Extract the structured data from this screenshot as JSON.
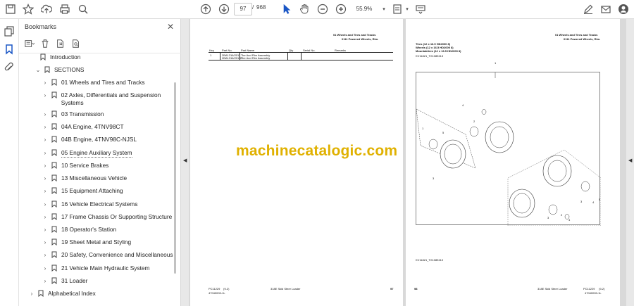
{
  "toolbar": {
    "current_page": "97",
    "page_separator": "/",
    "total_pages": "968",
    "zoom": "55.9%"
  },
  "bookmarks_panel": {
    "title": "Bookmarks",
    "items": [
      {
        "label": "Introduction",
        "level": 2,
        "expand": "none"
      },
      {
        "label": "SECTIONS",
        "level": 1,
        "expand": "expanded"
      },
      {
        "label": "01 Wheels and Tires and Tracks",
        "level": 2,
        "expand": "collapsed"
      },
      {
        "label": "02 Axles, Differentials and Suspension Systems",
        "level": 2,
        "expand": "collapsed"
      },
      {
        "label": "03 Transmission",
        "level": 2,
        "expand": "collapsed"
      },
      {
        "label": "04A Engine, 4TNV98CT",
        "level": 2,
        "expand": "collapsed"
      },
      {
        "label": "04B Engine, 4TNV98C-NJSL",
        "level": 2,
        "expand": "collapsed"
      },
      {
        "label": "05 Engine Auxiliary System",
        "level": 2,
        "expand": "collapsed"
      },
      {
        "label": "10 Service Brakes",
        "level": 2,
        "expand": "collapsed"
      },
      {
        "label": "13 Miscellaneous Vehicle",
        "level": 2,
        "expand": "collapsed"
      },
      {
        "label": "15 Equipment Attaching",
        "level": 2,
        "expand": "collapsed"
      },
      {
        "label": "16 Vehicle Electrical Systems",
        "level": 2,
        "expand": "collapsed"
      },
      {
        "label": "17 Frame Chassis Or Supporting Structure",
        "level": 2,
        "expand": "collapsed"
      },
      {
        "label": "18 Operator's Station",
        "level": 2,
        "expand": "collapsed"
      },
      {
        "label": "19 Sheet Metal and Styling",
        "level": 2,
        "expand": "collapsed"
      },
      {
        "label": "20 Safety, Convenience and Miscellaneous",
        "level": 2,
        "expand": "collapsed"
      },
      {
        "label": "21 Vehicle Main Hydraulic System",
        "level": 2,
        "expand": "collapsed"
      },
      {
        "label": "31 Loader",
        "level": 2,
        "expand": "collapsed"
      },
      {
        "label": "Alphabetical Index",
        "level": 0,
        "expand": "collapsed"
      }
    ]
  },
  "watermark": "machinecatalogic.com",
  "page_left": {
    "section": "01 Wheels and Tires and Tracks",
    "subsection": "0111 Powered Wheels, Rim.",
    "col_key": "Key",
    "col_part_no": "Part No.",
    "col_part_name": "Part Name",
    "col_qty": "Qty",
    "col_serial": "Serial No.",
    "col_remarks": "Remarks",
    "row1_key": "1",
    "row1_part": "2BA1316/2011",
    "row1_name": "Tire And Rim Assembly",
    "row2_part": "2BA1316/2011B",
    "row2_name": "Tire And Rim Assembly",
    "footer_left": "PC11229",
    "footer_left_code": "(9-2)",
    "footer_center": "318E Skid Steer Loader",
    "footer_page": "97",
    "footer_sub": "47040000-1L"
  },
  "page_right": {
    "section": "01 Wheels and Tires and Tracks",
    "subsection": "0111 Powered Wheels, Rim.",
    "line1": "Tires (12 x 16.5 HD2000 8)",
    "line2": "Wheels (12 x 16.5 HD2000 8)",
    "line3": "Mountaktires (12 x 16.5 HD2000 8)",
    "ref_code": "KV11821_TX1089413",
    "callouts": [
      "1",
      "4",
      "2",
      "1",
      "5",
      "3",
      "3",
      "4",
      "2",
      "4",
      "3",
      "5"
    ],
    "bottom_ref": "KV11821_TX1089410",
    "footer_page": "98",
    "footer_center": "318E Skid Steer Loader",
    "footer_right": "PC11229",
    "footer_right_code": "(9-2)",
    "footer_sub": "47040000-1L"
  }
}
